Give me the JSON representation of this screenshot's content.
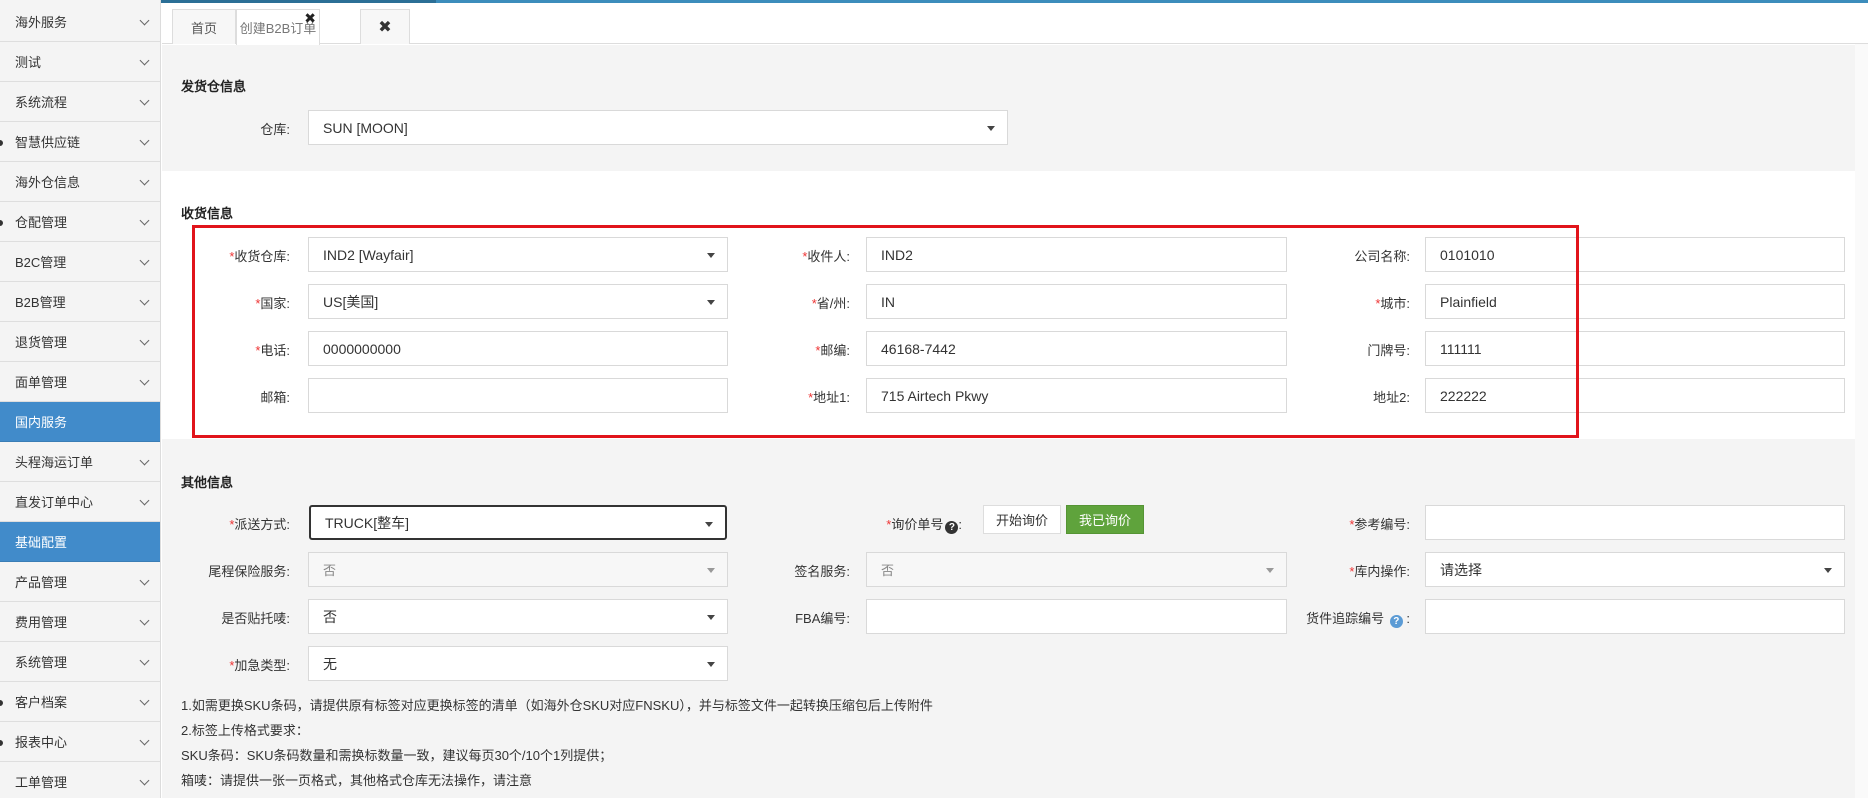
{
  "sidebar": {
    "items": [
      {
        "label": "海外服务",
        "active": false
      },
      {
        "label": "测试",
        "active": false
      },
      {
        "label": "系统流程",
        "active": false
      },
      {
        "label": "智慧供应链",
        "active": false
      },
      {
        "label": "海外仓信息",
        "active": false
      },
      {
        "label": "仓配管理",
        "active": false
      },
      {
        "label": "B2C管理",
        "active": false
      },
      {
        "label": "B2B管理",
        "active": false
      },
      {
        "label": "退货管理",
        "active": false
      },
      {
        "label": "面单管理",
        "active": false
      },
      {
        "label": "国内服务",
        "active": true
      },
      {
        "label": "头程海运订单",
        "active": false
      },
      {
        "label": "直发订单中心",
        "active": false
      },
      {
        "label": "基础配置",
        "active": true
      },
      {
        "label": "产品管理",
        "active": false
      },
      {
        "label": "费用管理",
        "active": false
      },
      {
        "label": "系统管理",
        "active": false
      },
      {
        "label": "客户档案",
        "active": false
      },
      {
        "label": "报表中心",
        "active": false
      },
      {
        "label": "工单管理",
        "active": false
      }
    ]
  },
  "tabs": {
    "home": "首页",
    "b2b": "创建B2B订单",
    "b2b_close": "✖",
    "close_all": "✖"
  },
  "ship_section": {
    "title": "发货仓信息",
    "warehouse_label": "仓库:",
    "warehouse_value": "SUN [MOON]"
  },
  "receive_section": {
    "title": "收货信息",
    "req_mark": "*",
    "fields": {
      "recv_warehouse": {
        "label": "收货仓库:",
        "value": "IND2 [Wayfair]"
      },
      "receiver": {
        "label": "收件人:",
        "value": "IND2"
      },
      "company": {
        "label": "公司名称:",
        "value": "0101010"
      },
      "country": {
        "label": "国家:",
        "value": "US[美国]"
      },
      "state": {
        "label": "省/州:",
        "value": "IN"
      },
      "city": {
        "label": "城市:",
        "value": "Plainfield"
      },
      "phone": {
        "label": "电话:",
        "value": "0000000000"
      },
      "zip": {
        "label": "邮编:",
        "value": "46168-7442"
      },
      "house_no": {
        "label": "门牌号:",
        "value": "111111"
      },
      "email": {
        "label": "邮箱:",
        "value": ""
      },
      "address1": {
        "label": "地址1:",
        "value": "715 Airtech Pkwy"
      },
      "address2": {
        "label": "地址2:",
        "value": "222222"
      }
    }
  },
  "other_section": {
    "title": "其他信息",
    "delivery": {
      "label": "派送方式:",
      "value": "TRUCK[整车]"
    },
    "inquiry": {
      "label": "询价单号",
      "help": "?",
      "colon": ":",
      "start_btn": "开始询价",
      "done_btn": "我已询价"
    },
    "reference": {
      "label": "参考编号:",
      "value": ""
    },
    "tail_insurance": {
      "label": "尾程保险服务:",
      "value": "否"
    },
    "signature": {
      "label": "签名服务:",
      "value": "否"
    },
    "warehouse_op": {
      "label": "库内操作:",
      "value": "请选择"
    },
    "pallet_label": {
      "label": "是否贴托唛:",
      "value": "否"
    },
    "fba": {
      "label": "FBA编号:",
      "value": ""
    },
    "tracking": {
      "label": "货件追踪编号",
      "help": "?",
      "colon": ":",
      "value": ""
    },
    "urgent": {
      "label": "加急类型:",
      "value": "无"
    }
  },
  "notes": [
    "1.如需更换SKU条码，请提供原有标签对应更换标签的清单（如海外仓SKU对应FNSKU），并与标签文件一起转换压缩包后上传附件",
    "2.标签上传格式要求：",
    "SKU条码：SKU条码数量和需换标数量一致，建议每页30个/10个1列提供；",
    "箱唛：请提供一张一页格式，其他格式仓库无法操作，请注意"
  ],
  "colors": {
    "accent": "#418bca",
    "highlight_box": "#e1141b",
    "required": "#e33333",
    "confirm_button": "#5fa33c"
  }
}
